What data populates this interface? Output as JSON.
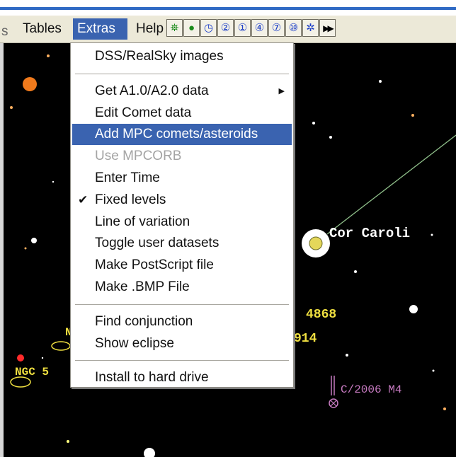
{
  "colors": {
    "menubar": "#ece9d8",
    "highlight": "#3a63b0",
    "sky": "#000000",
    "star_label": "#ffffff",
    "object_label": "#f0e040",
    "comet_label": "#c67ac0",
    "trail_line": "#8fbf8a"
  },
  "menubar": {
    "cut_item": "s",
    "items": [
      {
        "label": "Tables",
        "active": false
      },
      {
        "label": "Extras",
        "active": true
      },
      {
        "label": "Help",
        "active": false
      }
    ]
  },
  "toolbar": {
    "buttons": [
      {
        "icon": "comet-icon",
        "glyph": "⛯"
      },
      {
        "icon": "planet-icon",
        "glyph": "●"
      },
      {
        "icon": "clock-icon",
        "glyph": "◷"
      },
      {
        "icon": "zoom-2-icon",
        "glyph": "②"
      },
      {
        "icon": "zoom-1-icon",
        "glyph": "①"
      },
      {
        "icon": "zoom-4-icon",
        "glyph": "④"
      },
      {
        "icon": "zoom-7-icon",
        "glyph": "⑦"
      },
      {
        "icon": "zoom-10-icon",
        "glyph": "⑩"
      },
      {
        "icon": "satellite-icon",
        "glyph": "✲"
      },
      {
        "icon": "fast-forward-icon",
        "glyph": "▶▶"
      }
    ]
  },
  "extras_menu": {
    "items": [
      {
        "label": "DSS/RealSky images",
        "state": "normal"
      },
      {
        "separator": true
      },
      {
        "label": "Get A1.0/A2.0 data",
        "state": "normal",
        "submenu": true
      },
      {
        "label": "Edit Comet data",
        "state": "normal"
      },
      {
        "label": "Add MPC comets/asteroids",
        "state": "highlighted"
      },
      {
        "label": "Use MPCORB",
        "state": "disabled"
      },
      {
        "label": "Enter Time",
        "state": "normal"
      },
      {
        "label": "Fixed levels",
        "state": "normal",
        "checked": true
      },
      {
        "label": "Line of variation",
        "state": "normal"
      },
      {
        "label": "Toggle user datasets",
        "state": "normal"
      },
      {
        "label": "Make PostScript file",
        "state": "normal"
      },
      {
        "label": "Make .BMP File",
        "state": "normal"
      },
      {
        "separator": true
      },
      {
        "label": "Find conjunction",
        "state": "normal"
      },
      {
        "label": "Show eclipse",
        "state": "normal"
      },
      {
        "separator": true
      },
      {
        "label": "Install to hard drive",
        "state": "normal"
      }
    ],
    "check_glyph": "✔",
    "submenu_glyph": "▶"
  },
  "sky": {
    "labels": {
      "cor_caroli": "Cor Caroli",
      "ngc_4868": "4868",
      "ngc_4914": "914",
      "ngc_partial": "NGC 5",
      "comet": "C/2006 M4",
      "ngc_cut": "N"
    }
  }
}
